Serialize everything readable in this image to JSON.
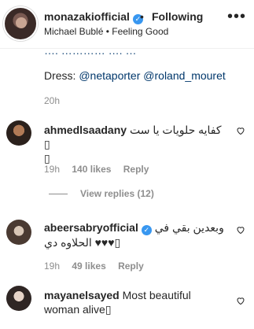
{
  "header": {
    "username": "monazakiofficial",
    "dot": "•",
    "follow_state": "Following",
    "subtitle": "Michael Bublé • Feeling Good",
    "more": "•••"
  },
  "caption": {
    "cut_line": "…. ………… …. …",
    "dress_label": "Dress:",
    "mentions": [
      "@netaporter",
      "@roland_mouret"
    ],
    "time": "20h"
  },
  "comments": [
    {
      "username": "ahmedlsaadany",
      "text_line1": "كفايه حلويات يا ست ",
      "text_line1_emoji": "▯",
      "text_line2": "▯",
      "time": "19h",
      "likes": "140 likes",
      "reply": "Reply"
    },
    {
      "username": "abeersabryofficial",
      "text_line1": "وبعدين بقي في",
      "text_line2": "الحلاوه دي ♥♥♥▯",
      "time": "19h",
      "likes": "49 likes",
      "reply": "Reply"
    },
    {
      "username": "mayanelsayed",
      "text_line1": "Most beautiful",
      "text_line2": "woman alive▯"
    }
  ],
  "view_replies": "View replies (12)",
  "colors": {
    "verified": "#3897f0",
    "mention": "#00376b",
    "meta": "#8e8e8e"
  }
}
